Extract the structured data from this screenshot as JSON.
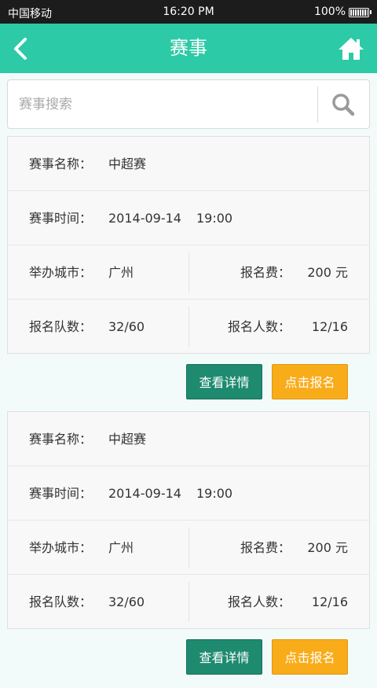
{
  "status_bar": {
    "carrier": "中国移动",
    "time": "16:20 PM",
    "battery": "100%"
  },
  "nav": {
    "title": "赛事",
    "back_icon": "chevron-left-icon",
    "home_icon": "home-icon"
  },
  "search": {
    "placeholder": "赛事搜索",
    "value": "",
    "icon": "search-icon"
  },
  "events": [
    {
      "name_label": "赛事名称：",
      "name": "中超赛",
      "time_label": "赛事时间：",
      "date": "2014-09-14",
      "time": "19:00",
      "city_label": "举办城市：",
      "city": "广州",
      "fee_label": "报名费：",
      "fee": "200 元",
      "teams_label": "报名队数：",
      "teams": "32/60",
      "people_label": "报名人数：",
      "people": "12/16",
      "detail_button": "查看详情",
      "signup_button": "点击报名"
    },
    {
      "name_label": "赛事名称：",
      "name": "中超赛",
      "time_label": "赛事时间：",
      "date": "2014-09-14",
      "time": "19:00",
      "city_label": "举办城市：",
      "city": "广州",
      "fee_label": "报名费：",
      "fee": "200 元",
      "teams_label": "报名队数：",
      "teams": "32/60",
      "people_label": "报名人数：",
      "people": "12/16",
      "detail_button": "查看详情",
      "signup_button": "点击报名"
    }
  ],
  "colors": {
    "header": "#2ccaa6",
    "detail_button": "#1e8a70",
    "signup_button": "#f9ac1a"
  }
}
